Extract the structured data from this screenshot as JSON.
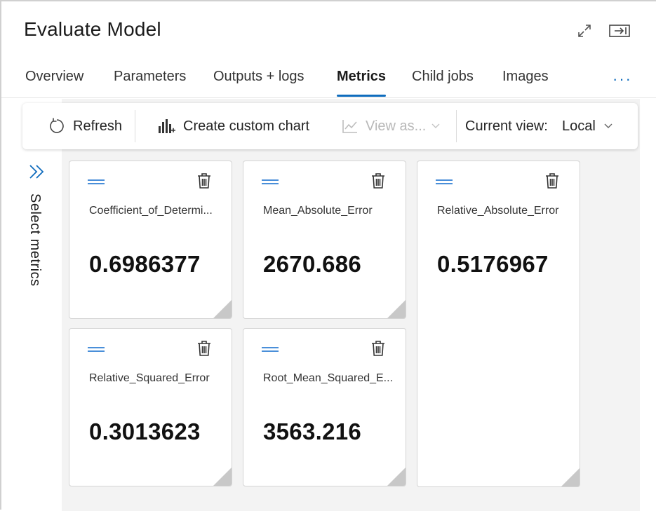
{
  "panel": {
    "title": "Evaluate Model"
  },
  "icons": {
    "expand": "expand-icon",
    "dock": "dock-panel-icon"
  },
  "tabs": [
    {
      "label": "Overview",
      "active": false
    },
    {
      "label": "Parameters",
      "active": false
    },
    {
      "label": "Outputs + logs",
      "active": false
    },
    {
      "label": "Metrics",
      "active": true
    },
    {
      "label": "Child jobs",
      "active": false
    },
    {
      "label": "Images",
      "active": false
    }
  ],
  "more_label": "···",
  "toolbar": {
    "refresh": "Refresh",
    "custom_chart": "Create custom chart",
    "view_as": "View as...",
    "current_view_label": "Current view:",
    "current_view_value": "Local"
  },
  "side": {
    "select_metrics": "Select metrics"
  },
  "metrics": [
    {
      "name": "Coefficient_of_Determi...",
      "value": "0.6986377"
    },
    {
      "name": "Mean_Absolute_Error",
      "value": "2670.686"
    },
    {
      "name": "Relative_Absolute_Error",
      "value": "0.5176967"
    },
    {
      "name": "Relative_Squared_Error",
      "value": "0.3013623"
    },
    {
      "name": "Root_Mean_Squared_E...",
      "value": "3563.216"
    }
  ],
  "colors": {
    "accent": "#0f6cbd",
    "drag_handle": "#4a8fd9",
    "content_bg": "#f3f3f3"
  }
}
